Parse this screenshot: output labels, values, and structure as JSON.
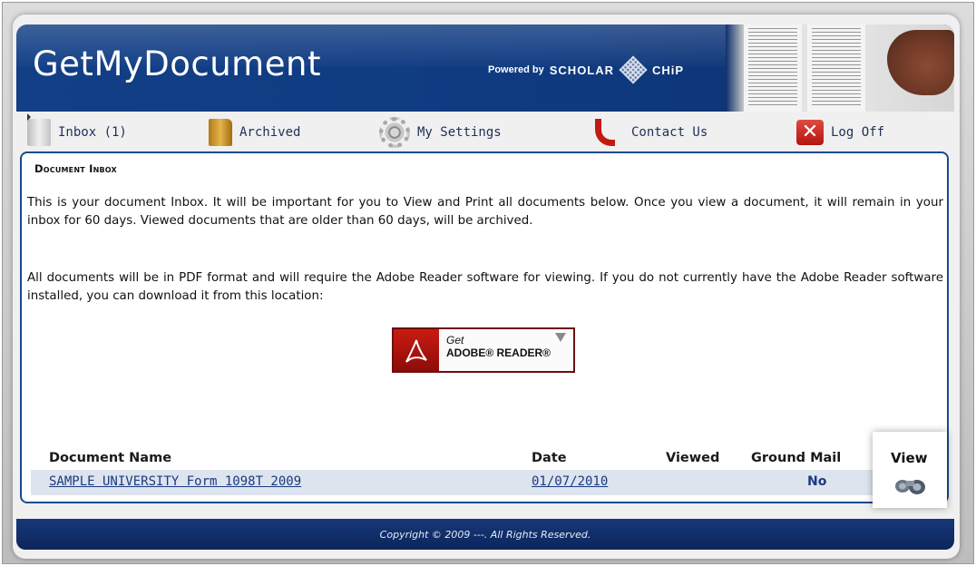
{
  "header": {
    "app_title": "GetMyDocument",
    "powered_by": "Powered by",
    "brand_left": "SCHOLAR",
    "brand_right": "CHiP"
  },
  "nav": {
    "items": [
      {
        "label": "Inbox (1)",
        "icon": "inbox-icon"
      },
      {
        "label": "Archived",
        "icon": "folder-icon"
      },
      {
        "label": "My Settings",
        "icon": "gear-icon"
      },
      {
        "label": "Contact Us",
        "icon": "phone-icon"
      },
      {
        "label": "Log Off",
        "icon": "logoff-icon"
      }
    ]
  },
  "content": {
    "section_title": "Document Inbox",
    "paragraph_1": "This is your document Inbox. It will be important for you to View and Print all documents below. Once you view a document, it will remain in your inbox for 60 days. Viewed documents that are older than 60 days, will be archived.",
    "paragraph_2": "All documents will be in PDF format and will require the Adobe Reader software for viewing. If you do not currently have the Adobe Reader software installed, you can download it from this location:",
    "adobe": {
      "get": "Get",
      "reader": "ADOBE® READER®"
    }
  },
  "table": {
    "headers": {
      "name": "Document Name",
      "date": "Date",
      "viewed": "Viewed",
      "ground_mail": "Ground Mail",
      "view": "View"
    },
    "rows": [
      {
        "name": "SAMPLE UNIVERSITY Form 1098T 2009",
        "date": "01/07/2010",
        "viewed": "",
        "ground_mail": "No",
        "view_icon": "binoculars-icon"
      }
    ]
  },
  "footer": {
    "copyright": "Copyright © 2009 ---. All Rights Reserved."
  },
  "colors": {
    "header_blue": "#123f86",
    "content_border": "#184a8f",
    "link_blue": "#1a3a80",
    "row_highlight": "#dde4ee"
  }
}
